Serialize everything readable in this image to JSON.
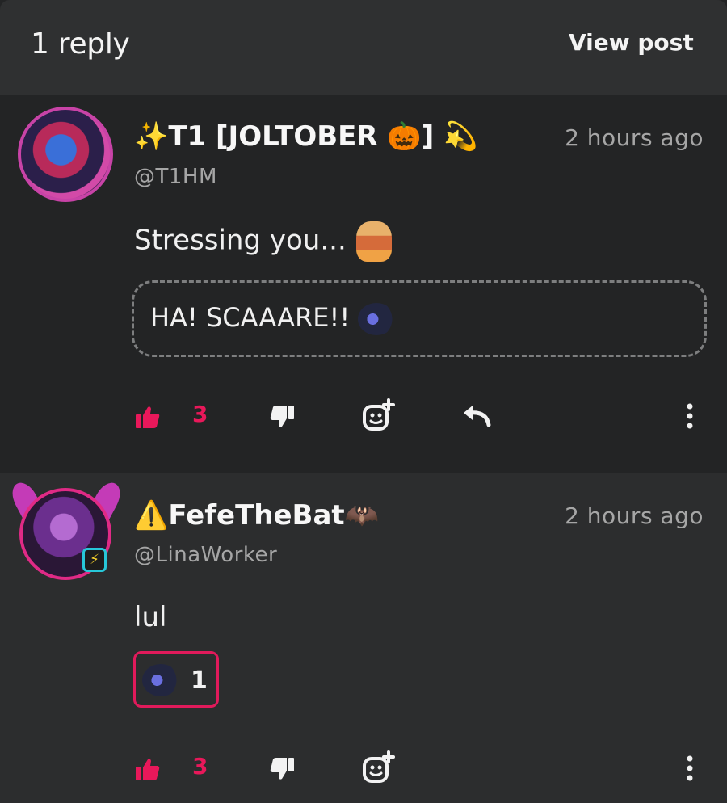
{
  "header": {
    "title": "1 reply",
    "view_post_label": "View post"
  },
  "comments": [
    {
      "display_name": "✨T1 [JOLTOBER 🎃] 💫",
      "handle": "@T1HM",
      "timestamp": "2 hours ago",
      "text": "Stressing you...",
      "quote": "HA! SCAAARE!!",
      "likes": "3"
    },
    {
      "display_name": "⚠️FefeTheBat🦇",
      "handle": "@LinaWorker",
      "timestamp": "2 hours ago",
      "text": "lul",
      "reaction_count": "1",
      "likes": "3"
    }
  ],
  "colors": {
    "accent": "#e8185a",
    "background": "#232425",
    "header": "#2f3031",
    "muted_text": "#a6a6a6"
  },
  "icons": [
    "thumbs-up-icon",
    "thumbs-down-icon",
    "add-reaction-icon",
    "reply-icon",
    "more-options-icon"
  ]
}
